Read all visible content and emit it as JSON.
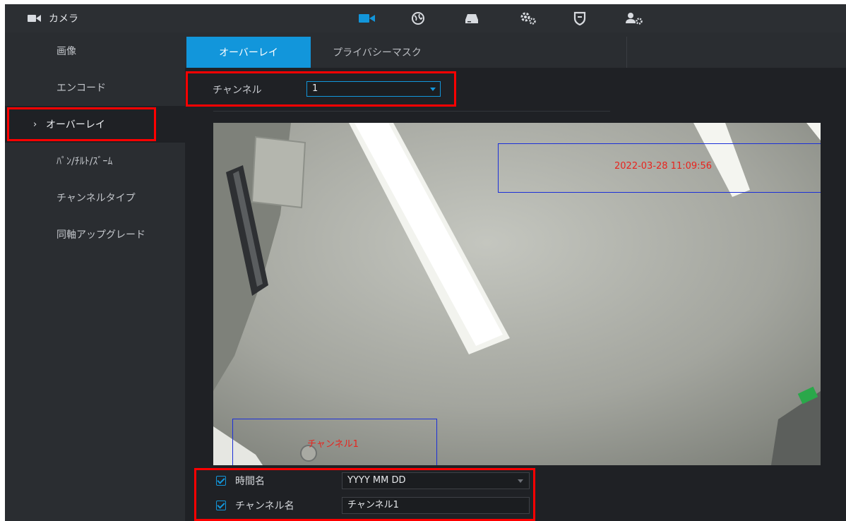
{
  "window": {
    "title": "カメラ",
    "title_icon": "camera-icon"
  },
  "top_nav": [
    {
      "icon": "camera-icon",
      "active": true
    },
    {
      "icon": "network-globe-icon",
      "active": false
    },
    {
      "icon": "storage-icon",
      "active": false
    },
    {
      "icon": "settings-gears-icon",
      "active": false
    },
    {
      "icon": "security-shield-icon",
      "active": false
    },
    {
      "icon": "account-icon",
      "active": false
    }
  ],
  "sidebar": {
    "items": [
      {
        "label": "画像",
        "active": false
      },
      {
        "label": "エンコード",
        "active": false
      },
      {
        "label": "オーバーレイ",
        "active": true,
        "marker": "›"
      },
      {
        "label": "ﾊﾟﾝ/ﾁﾙﾄ/ｽﾞｰﾑ",
        "active": false
      },
      {
        "label": "チャンネルタイプ",
        "active": false
      },
      {
        "label": "同軸アップグレード",
        "active": false
      }
    ]
  },
  "tabs": [
    {
      "label": "オーバーレイ",
      "active": true
    },
    {
      "label": "プライバシーマスク",
      "active": false
    }
  ],
  "channel": {
    "label": "チャンネル",
    "value": "1"
  },
  "preview": {
    "time_overlay": "2022-03-28 11:09:56",
    "channel_overlay": "チャンネル1"
  },
  "options": {
    "time_title": {
      "checked": true,
      "label": "時間名",
      "value": "YYYY MM DD"
    },
    "channel_title": {
      "checked": true,
      "label": "チャンネル名",
      "value": "チャンネル1"
    }
  },
  "colors": {
    "accent": "#1296db",
    "highlight": "#ff0000",
    "overlay_box": "#1b2fd8",
    "overlay_text": "#e8241e"
  }
}
